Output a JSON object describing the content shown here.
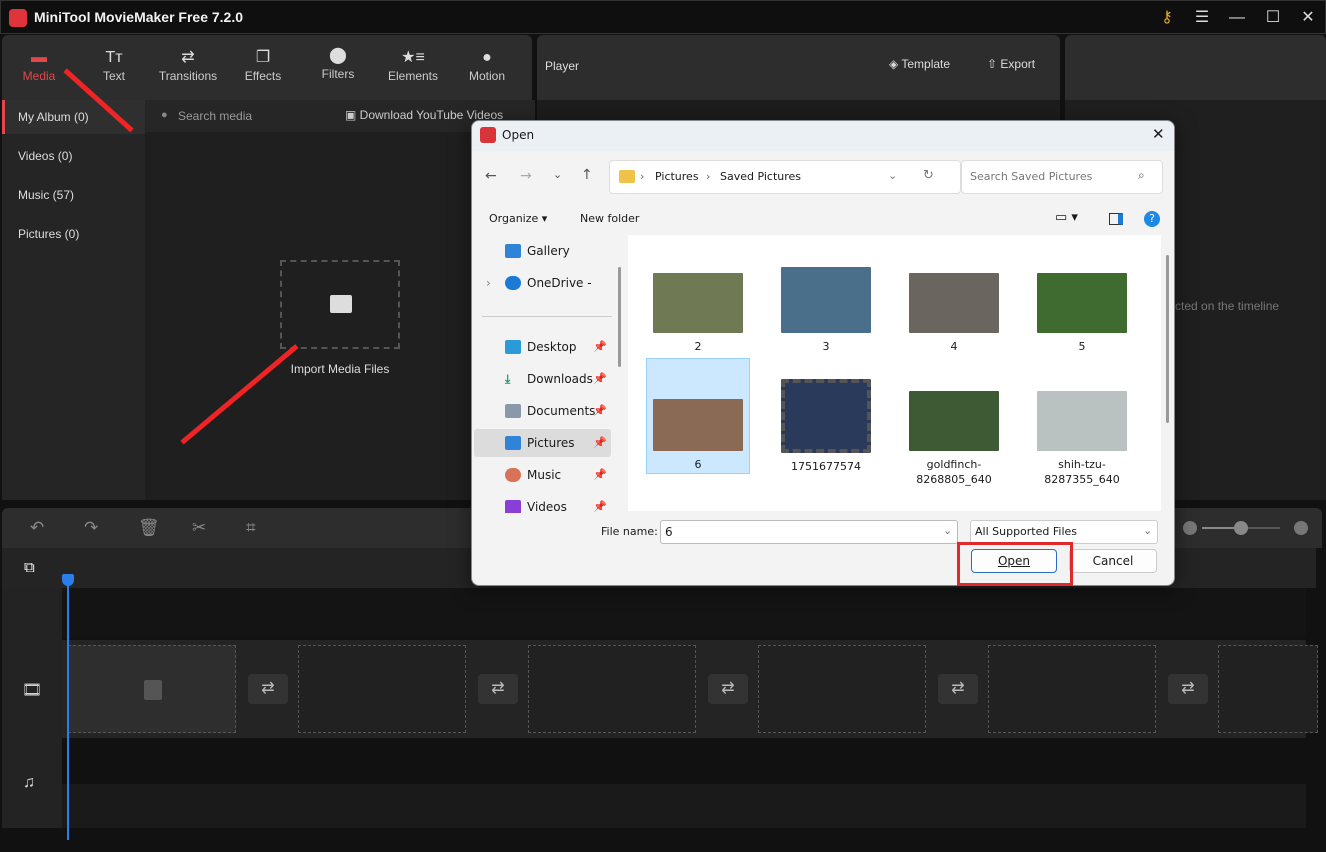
{
  "app": {
    "title": "MiniTool MovieMaker Free 7.2.0"
  },
  "toolbar": {
    "tabs": [
      {
        "label": "Media",
        "icon": "folder-icon",
        "active": true
      },
      {
        "label": "Text",
        "icon": "text-icon"
      },
      {
        "label": "Transitions",
        "icon": "transitions-icon"
      },
      {
        "label": "Effects",
        "icon": "effects-icon"
      },
      {
        "label": "Filters",
        "icon": "filters-icon"
      },
      {
        "label": "Elements",
        "icon": "elements-icon"
      },
      {
        "label": "Motion",
        "icon": "motion-icon"
      }
    ]
  },
  "player": {
    "title": "Player",
    "template_label": "Template",
    "export_label": "Export"
  },
  "properties": {
    "hint_partial": "cted on the timeline"
  },
  "sidebar": {
    "items": [
      {
        "label": "My Album (0)",
        "active": true
      },
      {
        "label": "Videos (0)"
      },
      {
        "label": "Music (57)"
      },
      {
        "label": "Pictures (0)"
      }
    ]
  },
  "media": {
    "search_placeholder": "Search media",
    "download_label": "Download YouTube Videos",
    "import_label": "Import Media Files"
  },
  "dialog": {
    "title": "Open",
    "breadcrumb": [
      "Pictures",
      "Saved Pictures"
    ],
    "search_placeholder": "Search Saved Pictures",
    "organize_label": "Organize",
    "new_folder_label": "New folder",
    "nav_items": [
      {
        "label": "Gallery"
      },
      {
        "label": "OneDrive - Perso"
      },
      {
        "label": "Desktop",
        "pinned": true
      },
      {
        "label": "Downloads",
        "pinned": true
      },
      {
        "label": "Documents",
        "pinned": true
      },
      {
        "label": "Pictures",
        "pinned": true,
        "selected": true
      },
      {
        "label": "Music",
        "pinned": true
      },
      {
        "label": "Videos",
        "pinned": true
      }
    ],
    "files": [
      {
        "name": "2",
        "color": "#6f7a55"
      },
      {
        "name": "3",
        "color": "#4a6f8a"
      },
      {
        "name": "4",
        "color": "#6b6560"
      },
      {
        "name": "5",
        "color": "#3f6a30"
      },
      {
        "name": "6",
        "color": "#8a6a55",
        "selected": true
      },
      {
        "name": "1751677574",
        "color": "#2a3a5a"
      },
      {
        "name": "goldfinch-8268805_640",
        "color": "#3d5a35"
      },
      {
        "name": "shih-tzu-8287355_640",
        "color": "#b9c2c0"
      }
    ],
    "file_name_label": "File name:",
    "file_name_value": "6",
    "file_type": "All Supported Files",
    "open_label": "Open",
    "cancel_label": "Cancel"
  },
  "timeline": {
    "zoom_level": 0.5
  }
}
